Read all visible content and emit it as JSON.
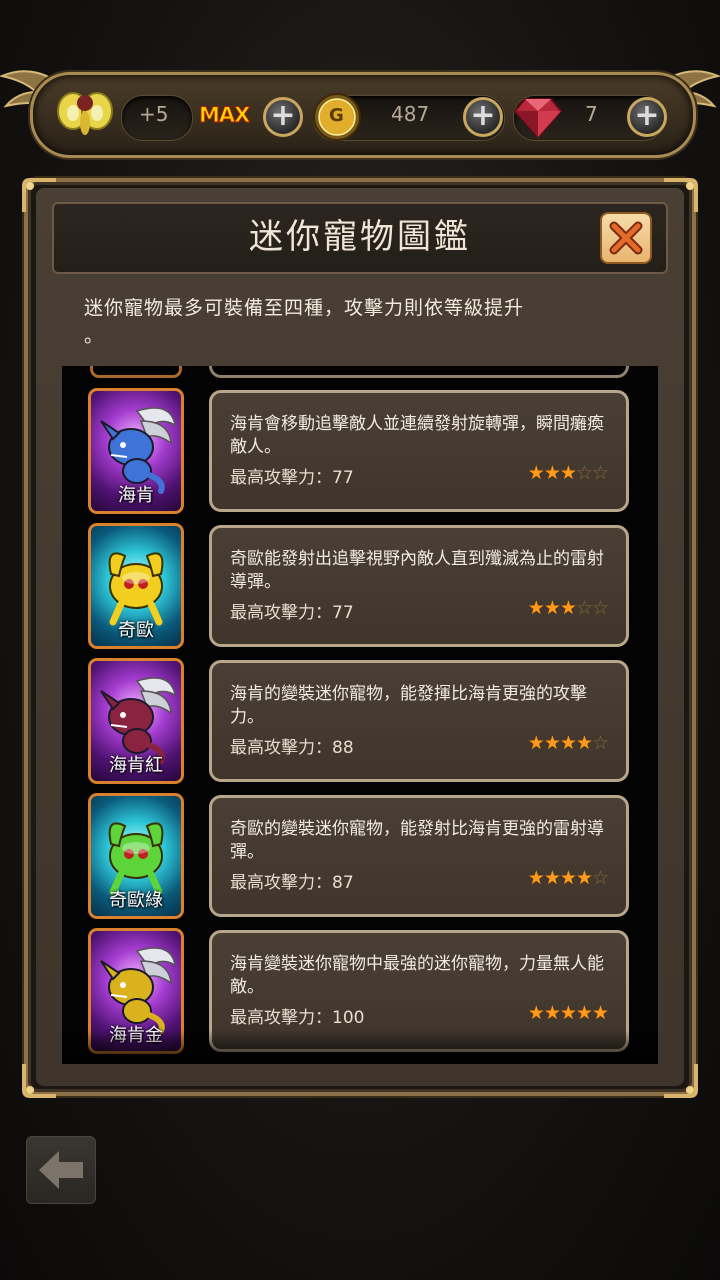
{
  "topbar": {
    "level_bonus": "+5",
    "max_label": "MAX",
    "gold_label": "G",
    "gold_amount": "487",
    "gem_amount": "7"
  },
  "panel": {
    "title": "迷你寵物圖鑑",
    "description_line1": "迷你寵物最多可裝備至四種，攻擊力則依等級提升",
    "description_line2": "。"
  },
  "pets": [
    {
      "name": "海肯",
      "text": "海肯會移動追擊敵人並連續發射旋轉彈，瞬間癱瘓敵人。",
      "attack_label": "最高攻擊力：77",
      "stars_filled": 3,
      "stars_total": 5,
      "card_theme": "purple",
      "creature_color": "#3f73d8"
    },
    {
      "name": "奇歐",
      "text": "奇歐能發射出追擊視野內敵人直到殲滅為止的雷射導彈。",
      "attack_label": "最高攻擊力：77",
      "stars_filled": 3,
      "stars_total": 5,
      "card_theme": "cyan",
      "creature_color": "#f2cf1e"
    },
    {
      "name": "海肯紅",
      "text": "海肯的變裝迷你寵物，能發揮比海肯更強的攻擊力。",
      "attack_label": "最高攻擊力：88",
      "stars_filled": 4,
      "stars_total": 5,
      "card_theme": "purple",
      "creature_color": "#8a2340"
    },
    {
      "name": "奇歐綠",
      "text": "奇歐的變裝迷你寵物，能發射比海肯更強的雷射導彈。",
      "attack_label": "最高攻擊力：87",
      "stars_filled": 4,
      "stars_total": 5,
      "card_theme": "cyan",
      "creature_color": "#5cd43a"
    },
    {
      "name": "海肯金",
      "text": "海肯變裝迷你寵物中最強的迷你寵物，力量無人能敵。",
      "attack_label": "最高攻擊力：100",
      "stars_filled": 5,
      "stars_total": 5,
      "card_theme": "purple",
      "creature_color": "#d9b21e"
    }
  ],
  "colors": {
    "frame_gold": "#a88a52",
    "star_on": "#ff9a1a",
    "card_border": "#d9812c",
    "close_button": "#f0c27e"
  }
}
